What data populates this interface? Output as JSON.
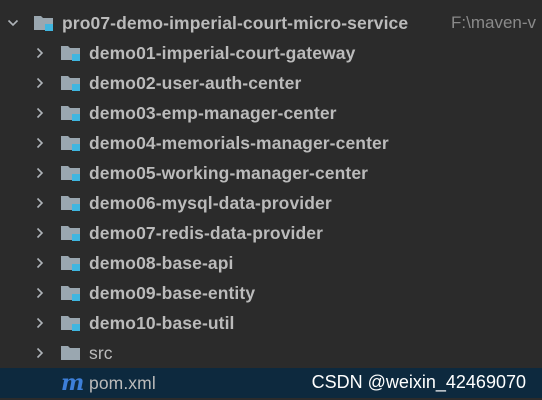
{
  "root": {
    "name": "pro07-demo-imperial-court-micro-service",
    "path": "F:\\maven-v"
  },
  "modules": [
    {
      "label": "demo01-imperial-court-gateway"
    },
    {
      "label": "demo02-user-auth-center"
    },
    {
      "label": "demo03-emp-manager-center"
    },
    {
      "label": "demo04-memorials-manager-center"
    },
    {
      "label": "demo05-working-manager-center"
    },
    {
      "label": "demo06-mysql-data-provider"
    },
    {
      "label": "demo07-redis-data-provider"
    },
    {
      "label": "demo08-base-api"
    },
    {
      "label": "demo09-base-entity"
    },
    {
      "label": "demo10-base-util"
    }
  ],
  "src_folder": {
    "label": "src"
  },
  "pom_file": {
    "label": "pom.xml",
    "icon_glyph": "m"
  },
  "watermark": "CSDN @weixin_42469070",
  "colors": {
    "background": "#2b2b2b",
    "text": "#bbbbbb",
    "folder": "#9aa7b0",
    "module_badge": "#40b6e0",
    "selected_row": "#0d293e",
    "maven_icon": "#3d7fd9"
  },
  "icons": {
    "expanded": "chevron-down-icon",
    "collapsed": "chevron-right-icon",
    "module_folder": "module-folder-icon",
    "folder": "folder-icon",
    "maven": "maven-icon"
  }
}
